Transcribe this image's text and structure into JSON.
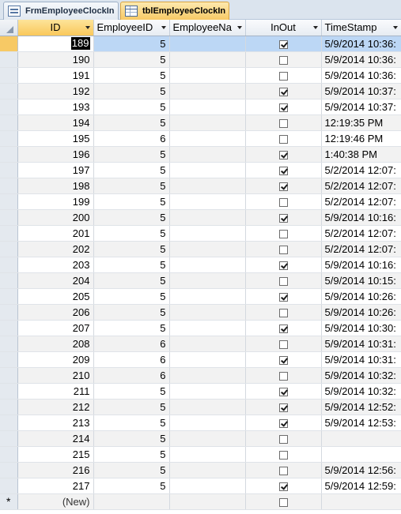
{
  "tabs": [
    {
      "label": "FrmEmployeeClockIn",
      "icon": "form-icon",
      "active": false
    },
    {
      "label": "tblEmployeeClockIn",
      "icon": "table-icon",
      "active": true
    }
  ],
  "columns": {
    "id": "ID",
    "employee_id": "EmployeeID",
    "employee_name": "EmployeeNa",
    "in_out": "InOut",
    "timestamp": "TimeStamp"
  },
  "rows": [
    {
      "id": "189",
      "employee_id": "5",
      "employee_name": "",
      "in_out": true,
      "timestamp": "5/9/2014 10:36:"
    },
    {
      "id": "190",
      "employee_id": "5",
      "employee_name": "",
      "in_out": false,
      "timestamp": "5/9/2014 10:36:"
    },
    {
      "id": "191",
      "employee_id": "5",
      "employee_name": "",
      "in_out": false,
      "timestamp": "5/9/2014 10:36:"
    },
    {
      "id": "192",
      "employee_id": "5",
      "employee_name": "",
      "in_out": true,
      "timestamp": "5/9/2014 10:37:"
    },
    {
      "id": "193",
      "employee_id": "5",
      "employee_name": "",
      "in_out": true,
      "timestamp": "5/9/2014 10:37:"
    },
    {
      "id": "194",
      "employee_id": "5",
      "employee_name": "",
      "in_out": false,
      "timestamp": "12:19:35 PM"
    },
    {
      "id": "195",
      "employee_id": "6",
      "employee_name": "",
      "in_out": false,
      "timestamp": "12:19:46 PM"
    },
    {
      "id": "196",
      "employee_id": "5",
      "employee_name": "",
      "in_out": true,
      "timestamp": "1:40:38 PM"
    },
    {
      "id": "197",
      "employee_id": "5",
      "employee_name": "",
      "in_out": true,
      "timestamp": "5/2/2014 12:07:"
    },
    {
      "id": "198",
      "employee_id": "5",
      "employee_name": "",
      "in_out": true,
      "timestamp": "5/2/2014 12:07:"
    },
    {
      "id": "199",
      "employee_id": "5",
      "employee_name": "",
      "in_out": false,
      "timestamp": "5/2/2014 12:07:"
    },
    {
      "id": "200",
      "employee_id": "5",
      "employee_name": "",
      "in_out": true,
      "timestamp": "5/9/2014 10:16:"
    },
    {
      "id": "201",
      "employee_id": "5",
      "employee_name": "",
      "in_out": false,
      "timestamp": "5/2/2014 12:07:"
    },
    {
      "id": "202",
      "employee_id": "5",
      "employee_name": "",
      "in_out": false,
      "timestamp": "5/2/2014 12:07:"
    },
    {
      "id": "203",
      "employee_id": "5",
      "employee_name": "",
      "in_out": true,
      "timestamp": "5/9/2014 10:16:"
    },
    {
      "id": "204",
      "employee_id": "5",
      "employee_name": "",
      "in_out": false,
      "timestamp": "5/9/2014 10:15:"
    },
    {
      "id": "205",
      "employee_id": "5",
      "employee_name": "",
      "in_out": true,
      "timestamp": "5/9/2014 10:26:"
    },
    {
      "id": "206",
      "employee_id": "5",
      "employee_name": "",
      "in_out": false,
      "timestamp": "5/9/2014 10:26:"
    },
    {
      "id": "207",
      "employee_id": "5",
      "employee_name": "",
      "in_out": true,
      "timestamp": "5/9/2014 10:30:"
    },
    {
      "id": "208",
      "employee_id": "6",
      "employee_name": "",
      "in_out": false,
      "timestamp": "5/9/2014 10:31:"
    },
    {
      "id": "209",
      "employee_id": "6",
      "employee_name": "",
      "in_out": true,
      "timestamp": "5/9/2014 10:31:"
    },
    {
      "id": "210",
      "employee_id": "6",
      "employee_name": "",
      "in_out": false,
      "timestamp": "5/9/2014 10:32:"
    },
    {
      "id": "211",
      "employee_id": "5",
      "employee_name": "",
      "in_out": true,
      "timestamp": "5/9/2014 10:32:"
    },
    {
      "id": "212",
      "employee_id": "5",
      "employee_name": "",
      "in_out": true,
      "timestamp": "5/9/2014 12:52:"
    },
    {
      "id": "213",
      "employee_id": "5",
      "employee_name": "",
      "in_out": true,
      "timestamp": "5/9/2014 12:53:"
    },
    {
      "id": "214",
      "employee_id": "5",
      "employee_name": "",
      "in_out": false,
      "timestamp": ""
    },
    {
      "id": "215",
      "employee_id": "5",
      "employee_name": "",
      "in_out": false,
      "timestamp": ""
    },
    {
      "id": "216",
      "employee_id": "5",
      "employee_name": "",
      "in_out": false,
      "timestamp": "5/9/2014 12:56:"
    },
    {
      "id": "217",
      "employee_id": "5",
      "employee_name": "",
      "in_out": true,
      "timestamp": "5/9/2014 12:59:"
    }
  ],
  "new_row": {
    "marker": "*",
    "id_label": "(New)",
    "in_out": false
  },
  "colors": {
    "selected_row": "#bcd7f5",
    "active_tab": "#f7c965",
    "alt_row": "#f2f2f2"
  }
}
